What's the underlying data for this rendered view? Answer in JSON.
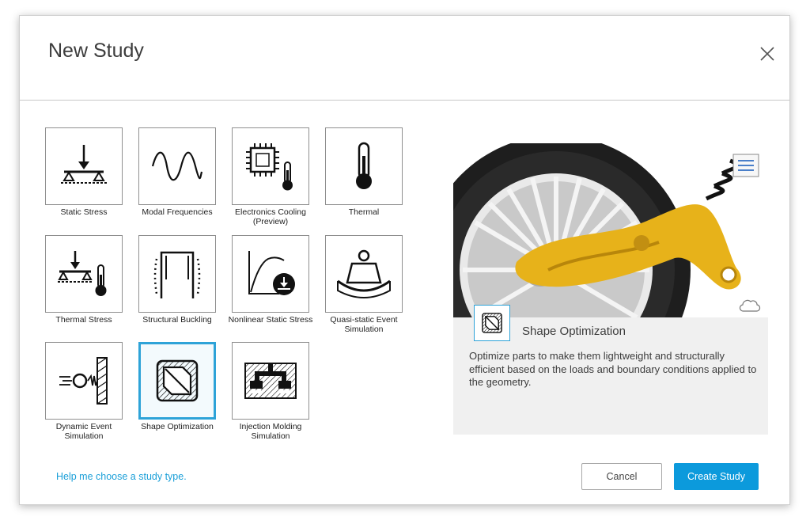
{
  "dialog": {
    "title": "New Study",
    "close_icon": "close-icon"
  },
  "study_types": [
    {
      "label": "Static Stress",
      "icon": "static-stress-icon"
    },
    {
      "label": "Modal Frequencies",
      "icon": "modal-frequencies-icon"
    },
    {
      "label": "Electronics Cooling (Preview)",
      "icon": "electronics-cooling-icon"
    },
    {
      "label": "Thermal",
      "icon": "thermometer-icon"
    },
    {
      "label": "Thermal Stress",
      "icon": "thermal-stress-icon"
    },
    {
      "label": "Structural Buckling",
      "icon": "structural-buckling-icon"
    },
    {
      "label": "Nonlinear Static Stress",
      "icon": "nonlinear-static-stress-icon"
    },
    {
      "label": "Quasi-static Event Simulation",
      "icon": "quasi-static-event-icon"
    },
    {
      "label": "Dynamic Event Simulation",
      "icon": "dynamic-event-icon"
    },
    {
      "label": "Shape Optimization",
      "icon": "shape-optimization-icon",
      "selected": true
    },
    {
      "label": "Injection Molding Simulation",
      "icon": "injection-molding-icon"
    }
  ],
  "preview": {
    "title": "Shape Optimization",
    "description": "Optimize parts to make them lightweight and structurally efficient based on the loads and boundary conditions applied to the geometry.",
    "image": "shape-optimization-preview-image"
  },
  "footer": {
    "help_link": "Help me choose a study type.",
    "cancel_label": "Cancel",
    "create_label": "Create Study"
  },
  "colors": {
    "accent": "#0c9adc",
    "selection_border": "#2ea3d8",
    "link": "#1a9fd8",
    "preview_bg": "#f0f0f0"
  }
}
